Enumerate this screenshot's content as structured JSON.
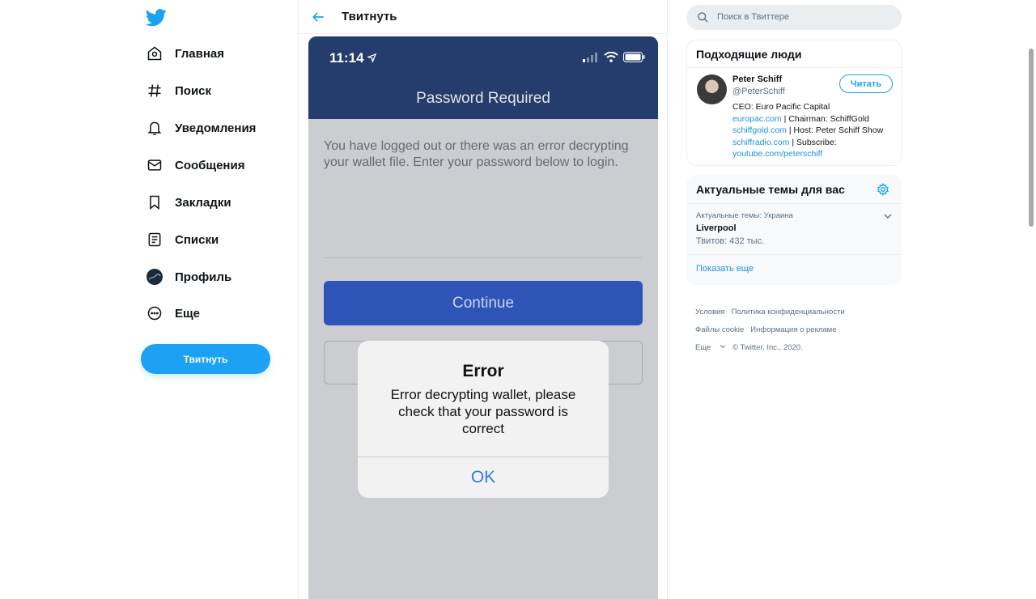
{
  "nav": {
    "items": [
      {
        "label": "Главная",
        "icon": "home-icon"
      },
      {
        "label": "Поиск",
        "icon": "hashtag-icon"
      },
      {
        "label": "Уведомления",
        "icon": "bell-icon"
      },
      {
        "label": "Сообщения",
        "icon": "mail-icon"
      },
      {
        "label": "Закладки",
        "icon": "bookmark-icon"
      },
      {
        "label": "Списки",
        "icon": "list-icon"
      },
      {
        "label": "Профиль",
        "icon": "avatar"
      },
      {
        "label": "Еще",
        "icon": "more-icon"
      }
    ],
    "tweet_button": "Твитнуть"
  },
  "center": {
    "title": "Твитнуть",
    "phone": {
      "time": "11:14",
      "screen_title": "Password Required",
      "message": "You have logged out or there was an error decrypting your wallet file. Enter your password below to login.",
      "continue_label": "Continue",
      "alert": {
        "title": "Error",
        "message": "Error decrypting wallet, please check that your password is correct",
        "ok_label": "OK"
      }
    }
  },
  "right": {
    "search_placeholder": "Поиск в Твиттере",
    "who_to_follow": {
      "title": "Подходящие люди",
      "user": {
        "name": "Peter Schiff",
        "handle": "@PeterSchiff",
        "follow_label": "Читать",
        "bio_1": "CEO: Euro Pacific Capital",
        "bio_link_1": "europac.com",
        "bio_2": " | Chairman: SchiffGold",
        "bio_link_2": "schiffgold.com",
        "bio_3": " | Host: Peter Schiff Show ",
        "bio_link_3": "schiffradio.com",
        "bio_4": " | Subscribe:",
        "bio_link_4": "youtube.com/peterschiff"
      }
    },
    "trends": {
      "title": "Актуальные темы для вас",
      "context": "Актуальные темы: Украина",
      "name": "Liverpool",
      "count": "Твитов: 432 тыс.",
      "show_more": "Показать еще"
    },
    "footer": {
      "terms": "Условия",
      "privacy": "Политика конфиденциальности",
      "cookies": "Файлы cookie",
      "ads": "Информация о рекламе",
      "more": "Еще",
      "copyright": "© Twitter, Inc., 2020."
    }
  },
  "colors": {
    "twitter_blue": "#1da1f2",
    "phone_header": "#253d6c",
    "continue_button": "#2f54b8"
  }
}
